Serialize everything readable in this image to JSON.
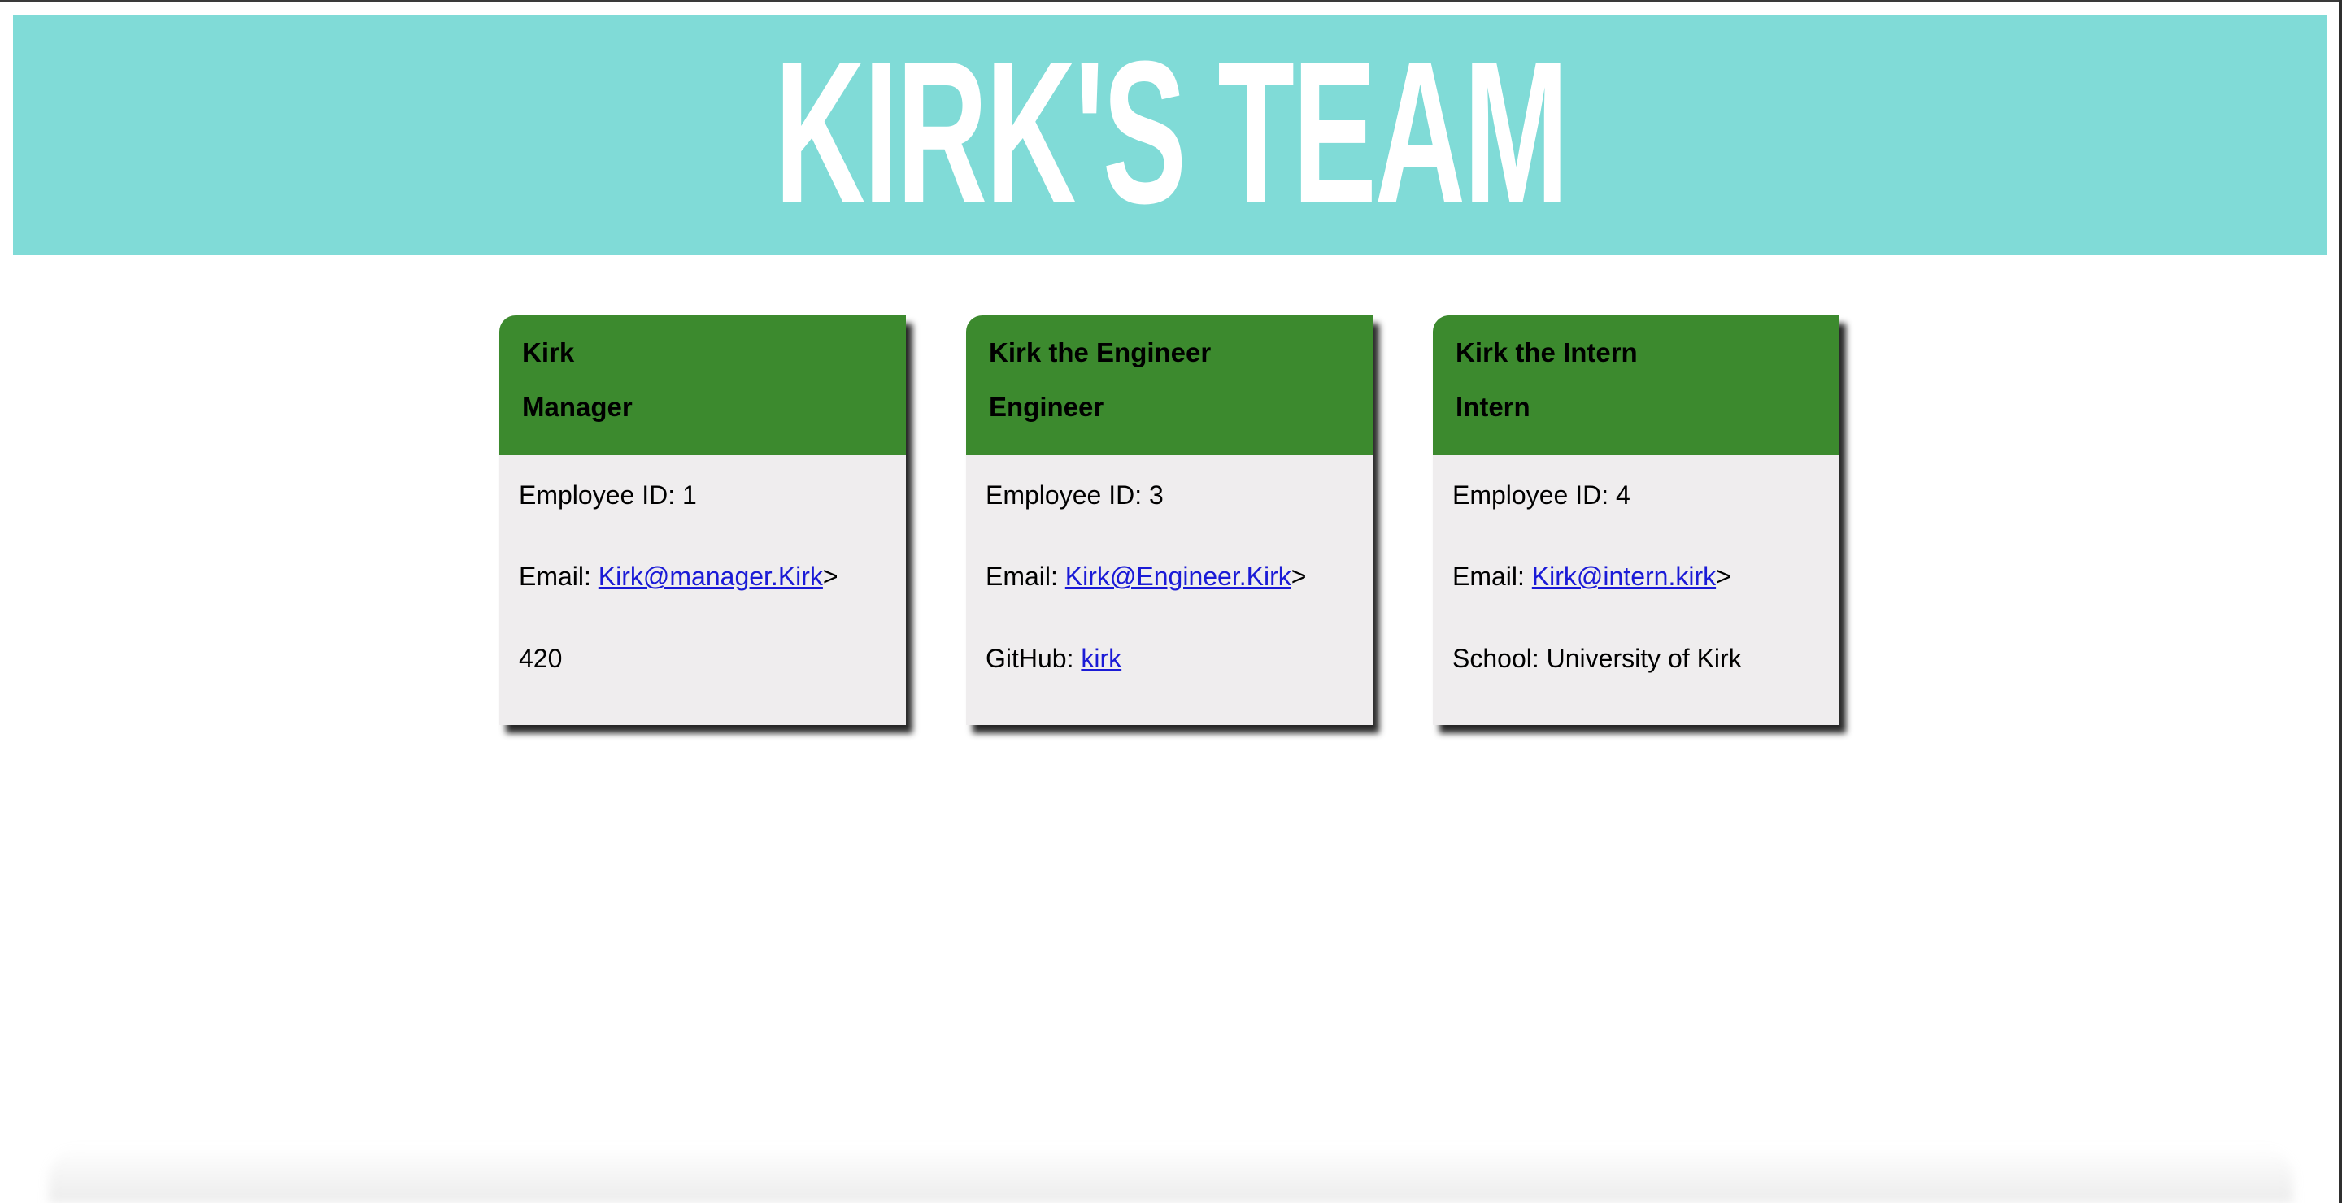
{
  "header": {
    "title": "KIRK'S TEAM"
  },
  "colors": {
    "header_bg": "#80dbd7",
    "card_head_bg": "#3c8a2e",
    "card_body_bg": "#efedee",
    "link": "#1a1ad6"
  },
  "cards": [
    {
      "name": "Kirk",
      "role": "Manager",
      "id_label": "Employee ID: 1",
      "email_prefix": "Email: ",
      "email": "Kirk@manager.Kirk",
      "email_suffix": ">",
      "extra_prefix": "",
      "extra_value": "420"
    },
    {
      "name": "Kirk the Engineer",
      "role": "Engineer",
      "id_label": "Employee ID: 3",
      "email_prefix": "Email: ",
      "email": "Kirk@Engineer.Kirk",
      "email_suffix": ">",
      "extra_prefix": "GitHub: ",
      "extra_link": "kirk"
    },
    {
      "name": "Kirk the Intern",
      "role": "Intern",
      "id_label": "Employee ID: 4",
      "email_prefix": "Email: ",
      "email": "Kirk@intern.kirk",
      "email_suffix": ">",
      "extra_prefix": "",
      "extra_value": "School: University of Kirk"
    }
  ]
}
